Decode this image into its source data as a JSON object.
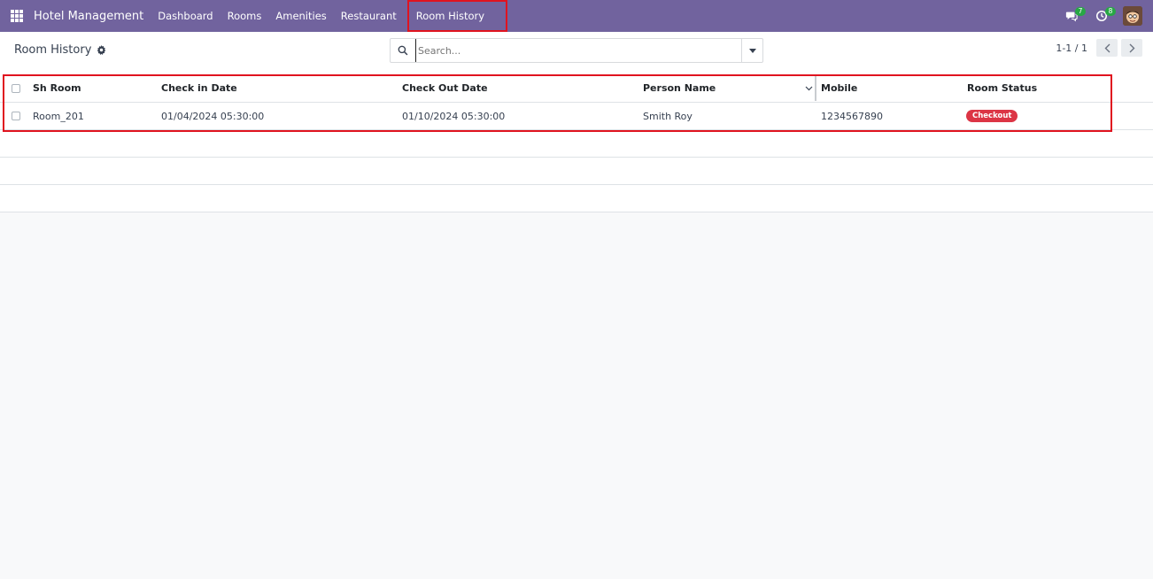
{
  "navbar": {
    "brand": "Hotel Management",
    "menu": [
      "Dashboard",
      "Rooms",
      "Amenities",
      "Restaurant",
      "Room History"
    ],
    "messages_count": "7",
    "activities_count": "8",
    "bg_color": "#71639e"
  },
  "control_panel": {
    "title": "Room History",
    "search_placeholder": "Search...",
    "pager": "1-1 / 1"
  },
  "table": {
    "columns": [
      "Sh Room",
      "Check in Date",
      "Check Out Date",
      "Person Name",
      "Mobile",
      "Room Status"
    ],
    "rows": [
      {
        "sh_room": "Room_201",
        "check_in": "01/04/2024 05:30:00",
        "check_out": "01/10/2024 05:30:00",
        "person": "Smith Roy",
        "mobile": "1234567890",
        "status": "Checkout"
      }
    ]
  },
  "icons": {
    "apps": "apps-grid-icon",
    "settings": "gear-icon",
    "search": "search-icon",
    "dropdown": "caret-down-icon",
    "prev": "chevron-left-icon",
    "next": "chevron-right-icon",
    "messages": "chat-icon",
    "activities": "clock-icon"
  },
  "colors": {
    "status_checkout": "#dc3545",
    "highlight": "#e0131f"
  }
}
